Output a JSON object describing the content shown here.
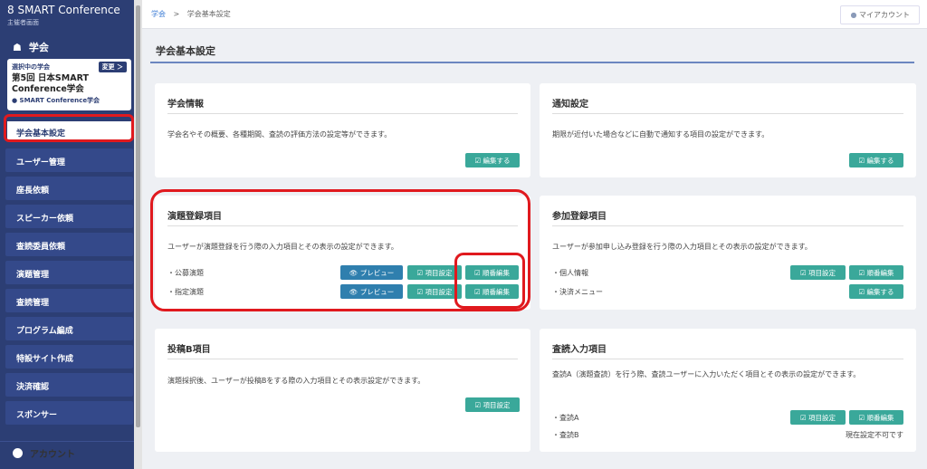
{
  "sidebar": {
    "brand": "8 SMART Conference",
    "brand_sub": "主催者画面",
    "section": "学会",
    "selected": {
      "label": "選択中の学会",
      "change": "変更 ＞",
      "name": "第5回 日本SMART Conference学会",
      "org": "SMART Conference学会"
    },
    "active_item": "学会基本設定",
    "items": [
      "ユーザー管理",
      "座長依頼",
      "スピーカー依頼",
      "査読委員依頼",
      "演題管理",
      "査読管理",
      "プログラム編成",
      "特設サイト作成",
      "決済確認",
      "スポンサー"
    ],
    "account": "アカウント"
  },
  "topbar": {
    "breadcrumb_link": "学会",
    "breadcrumb_sep": ">",
    "breadcrumb_current": "学会基本設定",
    "my_account": "マイアカウント"
  },
  "main": {
    "title": "学会基本設定",
    "cards": {
      "info": {
        "title": "学会情報",
        "desc": "学会名やその概要、各種期間、査読の評価方法の設定等ができます。",
        "edit": "編集する"
      },
      "notify": {
        "title": "通知設定",
        "desc": "期限が近付いた場合などに自動で通知する項目の設定ができます。",
        "edit": "編集する"
      },
      "abstract": {
        "title": "演題登録項目",
        "desc": "ユーザーが演題登録を行う際の入力項目とその表示の設定ができます。",
        "rows": [
          {
            "label": "・公募演題",
            "preview": "プレビュー",
            "fields": "項目設定",
            "order": "順番編集"
          },
          {
            "label": "・指定演題",
            "preview": "プレビュー",
            "fields": "項目設定",
            "order": "順番編集"
          }
        ]
      },
      "participant": {
        "title": "参加登録項目",
        "desc": "ユーザーが参加申し込み登録を行う際の入力項目とその表示の設定ができます。",
        "row1_label": "・個人情報",
        "row1_fields": "項目設定",
        "row1_order": "順番編集",
        "row2_label": "・決済メニュー",
        "row2_edit": "編集する"
      },
      "submissionB": {
        "title": "投稿B項目",
        "desc": "演題採択後、ユーザーが投稿Bをする際の入力項目とその表示設定ができます。",
        "fields": "項目設定"
      },
      "review": {
        "title": "査読入力項目",
        "desc": "査読A（演題査読）を行う際、査読ユーザーに入力いただく項目とその表示の設定ができます。",
        "row1_label": "・査読A",
        "row1_fields": "項目設定",
        "row1_order": "順番編集",
        "row2_label": "・査読B",
        "row2_note": "現在設定不可です"
      }
    }
  },
  "colors": {
    "sidebar": "#2c3e74",
    "button_green": "#3aa89a",
    "button_blue": "#2f7fae",
    "highlight_red": "#e0191e"
  }
}
